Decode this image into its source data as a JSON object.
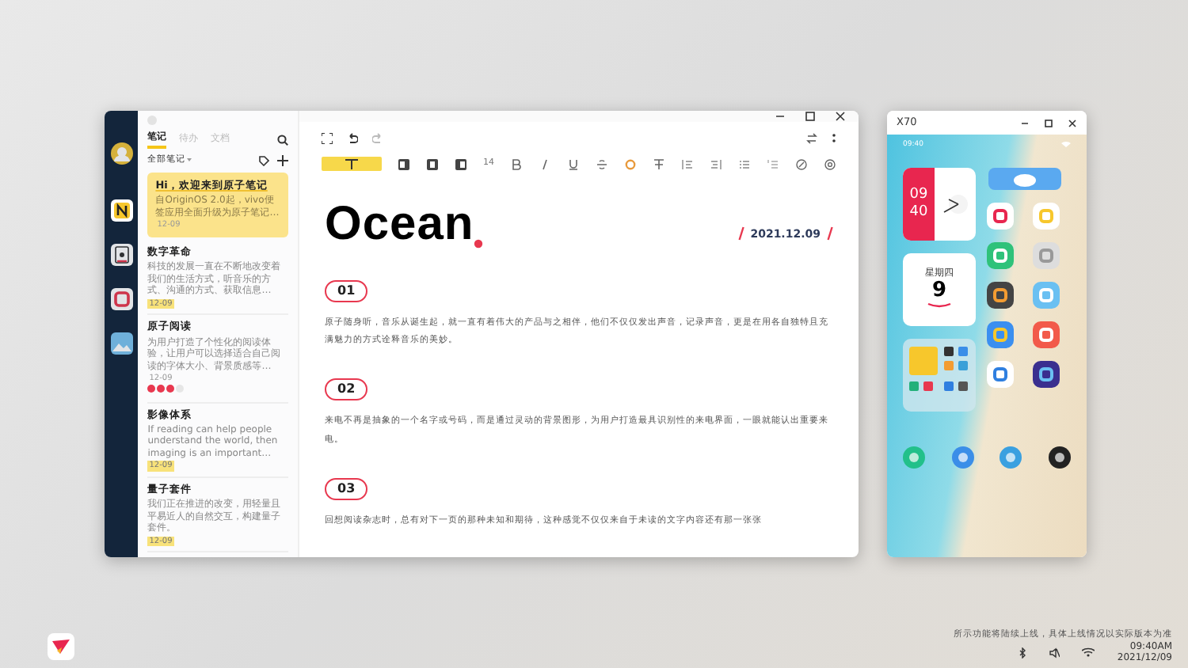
{
  "notes_window": {
    "rail": [
      {
        "kind": "avatar",
        "selected": false
      },
      {
        "kind": "notes",
        "selected": true
      },
      {
        "kind": "calendar",
        "selected": false
      },
      {
        "kind": "square",
        "selected": false
      },
      {
        "kind": "gallery",
        "selected": false
      }
    ],
    "tabs": [
      {
        "label": "笔记",
        "selected": true
      },
      {
        "label": "待办",
        "selected": false
      },
      {
        "label": "文档",
        "selected": false
      }
    ],
    "filter": "全部笔记",
    "notes": [
      {
        "kind": "welcome",
        "title": "Hi，欢迎来到原子笔记",
        "preview": "自OriginOS 2.0起，vivo便签应用全面升级为原子笔记…",
        "date": "12-09",
        "date_highlight": false
      },
      {
        "kind": "note",
        "title": "数字革命",
        "preview": "科技的发展一直在不断地改变着我们的生活方式，听音乐的方式、沟通的方式、获取信息…",
        "date": "12-09",
        "date_highlight": true
      },
      {
        "kind": "note",
        "title": "原子阅读",
        "preview": "为用户打造了个性化的阅读体验，让用户可以选择适合自己阅读的字体大小、背景质感等…",
        "date": "12-09",
        "date_highlight": false,
        "tags": [
          {
            "color": "#e8384f"
          },
          {
            "color": "#e8384f"
          },
          {
            "color": "#e8384f"
          },
          {
            "color": "#e6e6e6"
          }
        ]
      },
      {
        "kind": "note",
        "title": "影像体系",
        "preview": "If reading can help people understand the world, then imaging is an important…",
        "date": "12-09",
        "date_highlight": true
      },
      {
        "kind": "note",
        "title": "量子套件",
        "preview": "我们正在推进的改变，用轻量且平易近人的自然交互，构建量子套件。",
        "date": "12-09",
        "date_highlight": true
      }
    ],
    "editor": {
      "font_size": "14",
      "title": "Ocean",
      "date": "2021.12.09",
      "sections": [
        {
          "number": "01",
          "text": "原子随身听，音乐从诞生起，就一直有着伟大的产品与之相伴，他们不仅仅发出声音，记录声音，更是在用各自独特且充满魅力的方式诠释音乐的美妙。"
        },
        {
          "number": "02",
          "text": "来电不再是抽象的一个名字或号码，而是通过灵动的背景图形，为用户打造最具识别性的来电界面，一眼就能认出重要来电。"
        },
        {
          "number": "03",
          "text": "回想阅读杂志时，总有对下一页的那种未知和期待，这种感觉不仅仅来自于未读的文字内容还有那一张张"
        }
      ]
    }
  },
  "phone_window": {
    "title": "X70",
    "status_time": "09:40",
    "clock_hour": "09",
    "clock_minute": "40",
    "calendar_weekday": "星期四",
    "calendar_day": "9"
  },
  "taskbar": {
    "notice": "所示功能将陆续上线，具体上线情况以实际版本为准",
    "time": "09:40AM",
    "date": "2021/12/09"
  }
}
